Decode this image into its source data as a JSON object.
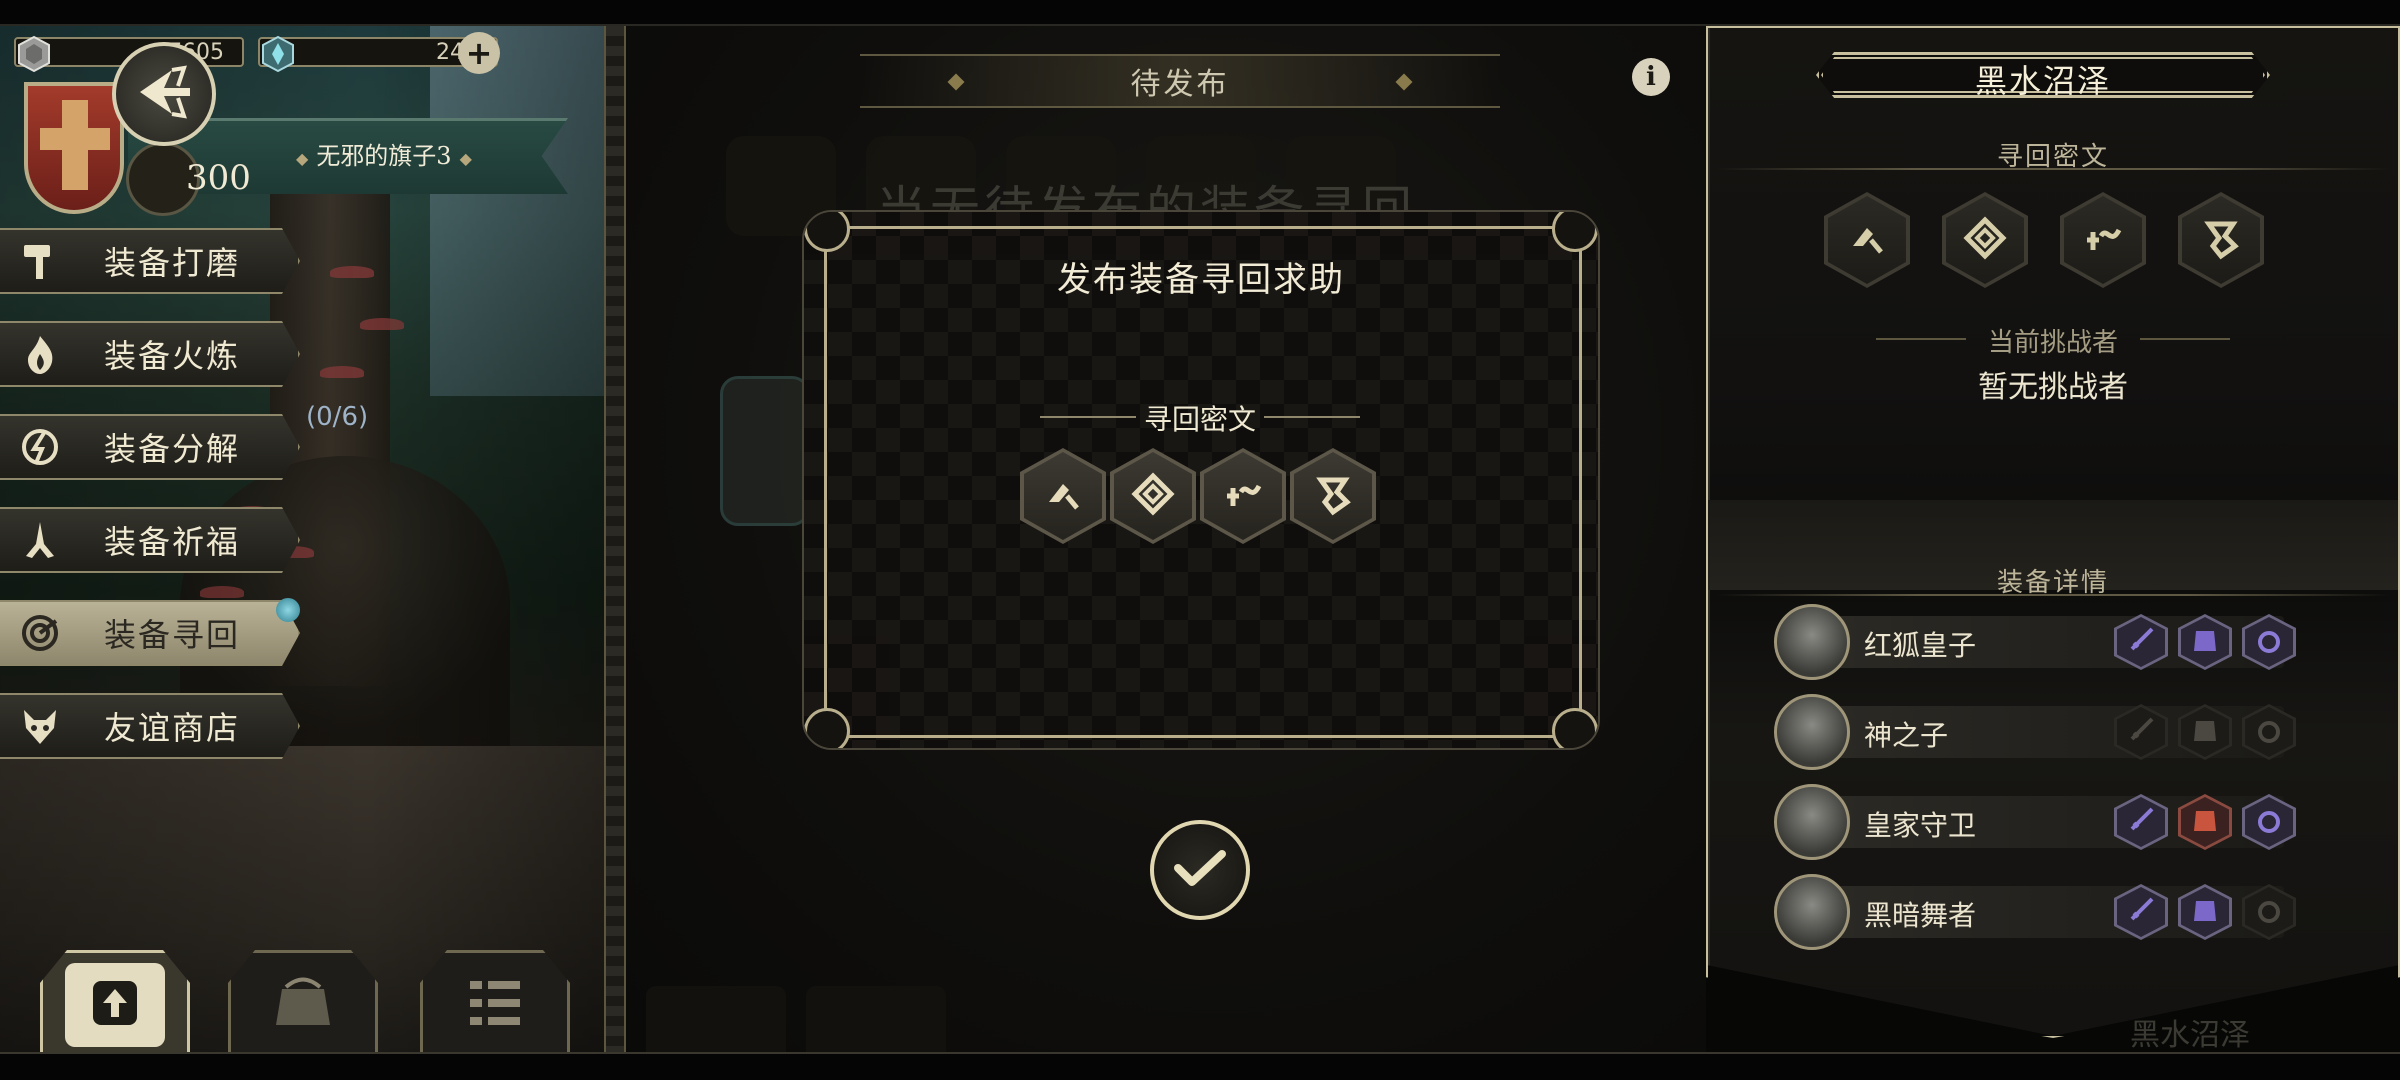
{
  "currency": {
    "gold": {
      "value": "17605",
      "icon": "silver-coin-icon"
    },
    "gems": {
      "value": "241",
      "icon": "crystal-icon",
      "add_icon": "plus-icon"
    }
  },
  "profile": {
    "banner_name": "无邪的旗子3",
    "level": "300",
    "back_icon": "arrow-back-icon",
    "crest_icon": "shield-crest-icon"
  },
  "menu": {
    "items": [
      {
        "label": "装备打磨",
        "icon": "hammer-icon"
      },
      {
        "label": "装备火炼",
        "icon": "flame-icon"
      },
      {
        "label": "装备分解",
        "icon": "disassemble-icon"
      },
      {
        "label": "装备祈福",
        "icon": "praying-hands-icon"
      },
      {
        "label": "装备寻回",
        "icon": "spiral-target-icon",
        "active": true
      },
      {
        "label": "友谊商店",
        "icon": "fox-icon"
      }
    ],
    "progress_text": "(0/6)"
  },
  "bottom_buttons": [
    {
      "icon": "upload-icon"
    },
    {
      "icon": "pouch-icon"
    },
    {
      "icon": "list-icon"
    }
  ],
  "center": {
    "header": "待发布",
    "background_text": "当无待发布的装备寻回",
    "info_icon": "info-icon",
    "confirm_icon": "checkmark-icon"
  },
  "modal": {
    "title": "发布装备寻回求助",
    "rune_caption": "寻回密文",
    "runes": [
      "rune-1-icon",
      "rune-2-icon",
      "rune-3-icon",
      "rune-4-icon"
    ]
  },
  "right_panel": {
    "title": "黑水沼泽",
    "rune_header": "寻回密文",
    "runes": [
      "rune-1-icon",
      "rune-2-icon",
      "rune-3-icon",
      "rune-4-icon"
    ],
    "challenger_label": "当前挑战者",
    "challenger_value": "暂无挑战者",
    "equipment_header": "装备详情",
    "heroes": [
      {
        "name": "红狐皇子",
        "weapon": "filled",
        "armor": "filled",
        "ring": "filled"
      },
      {
        "name": "神之子",
        "weapon": "empty",
        "armor": "empty",
        "ring": "empty"
      },
      {
        "name": "皇家守卫",
        "weapon": "filled",
        "armor": "red",
        "ring": "filled"
      },
      {
        "name": "黑暗舞者",
        "weapon": "filled",
        "armor": "filled",
        "ring": "empty"
      }
    ],
    "footer_ghost": "黑水沼泽"
  },
  "colors": {
    "accent_gold": "#c8bf9e",
    "equip_purple": "#6a6480",
    "equip_red": "#8a4a40",
    "text_light": "#f0ead2"
  }
}
